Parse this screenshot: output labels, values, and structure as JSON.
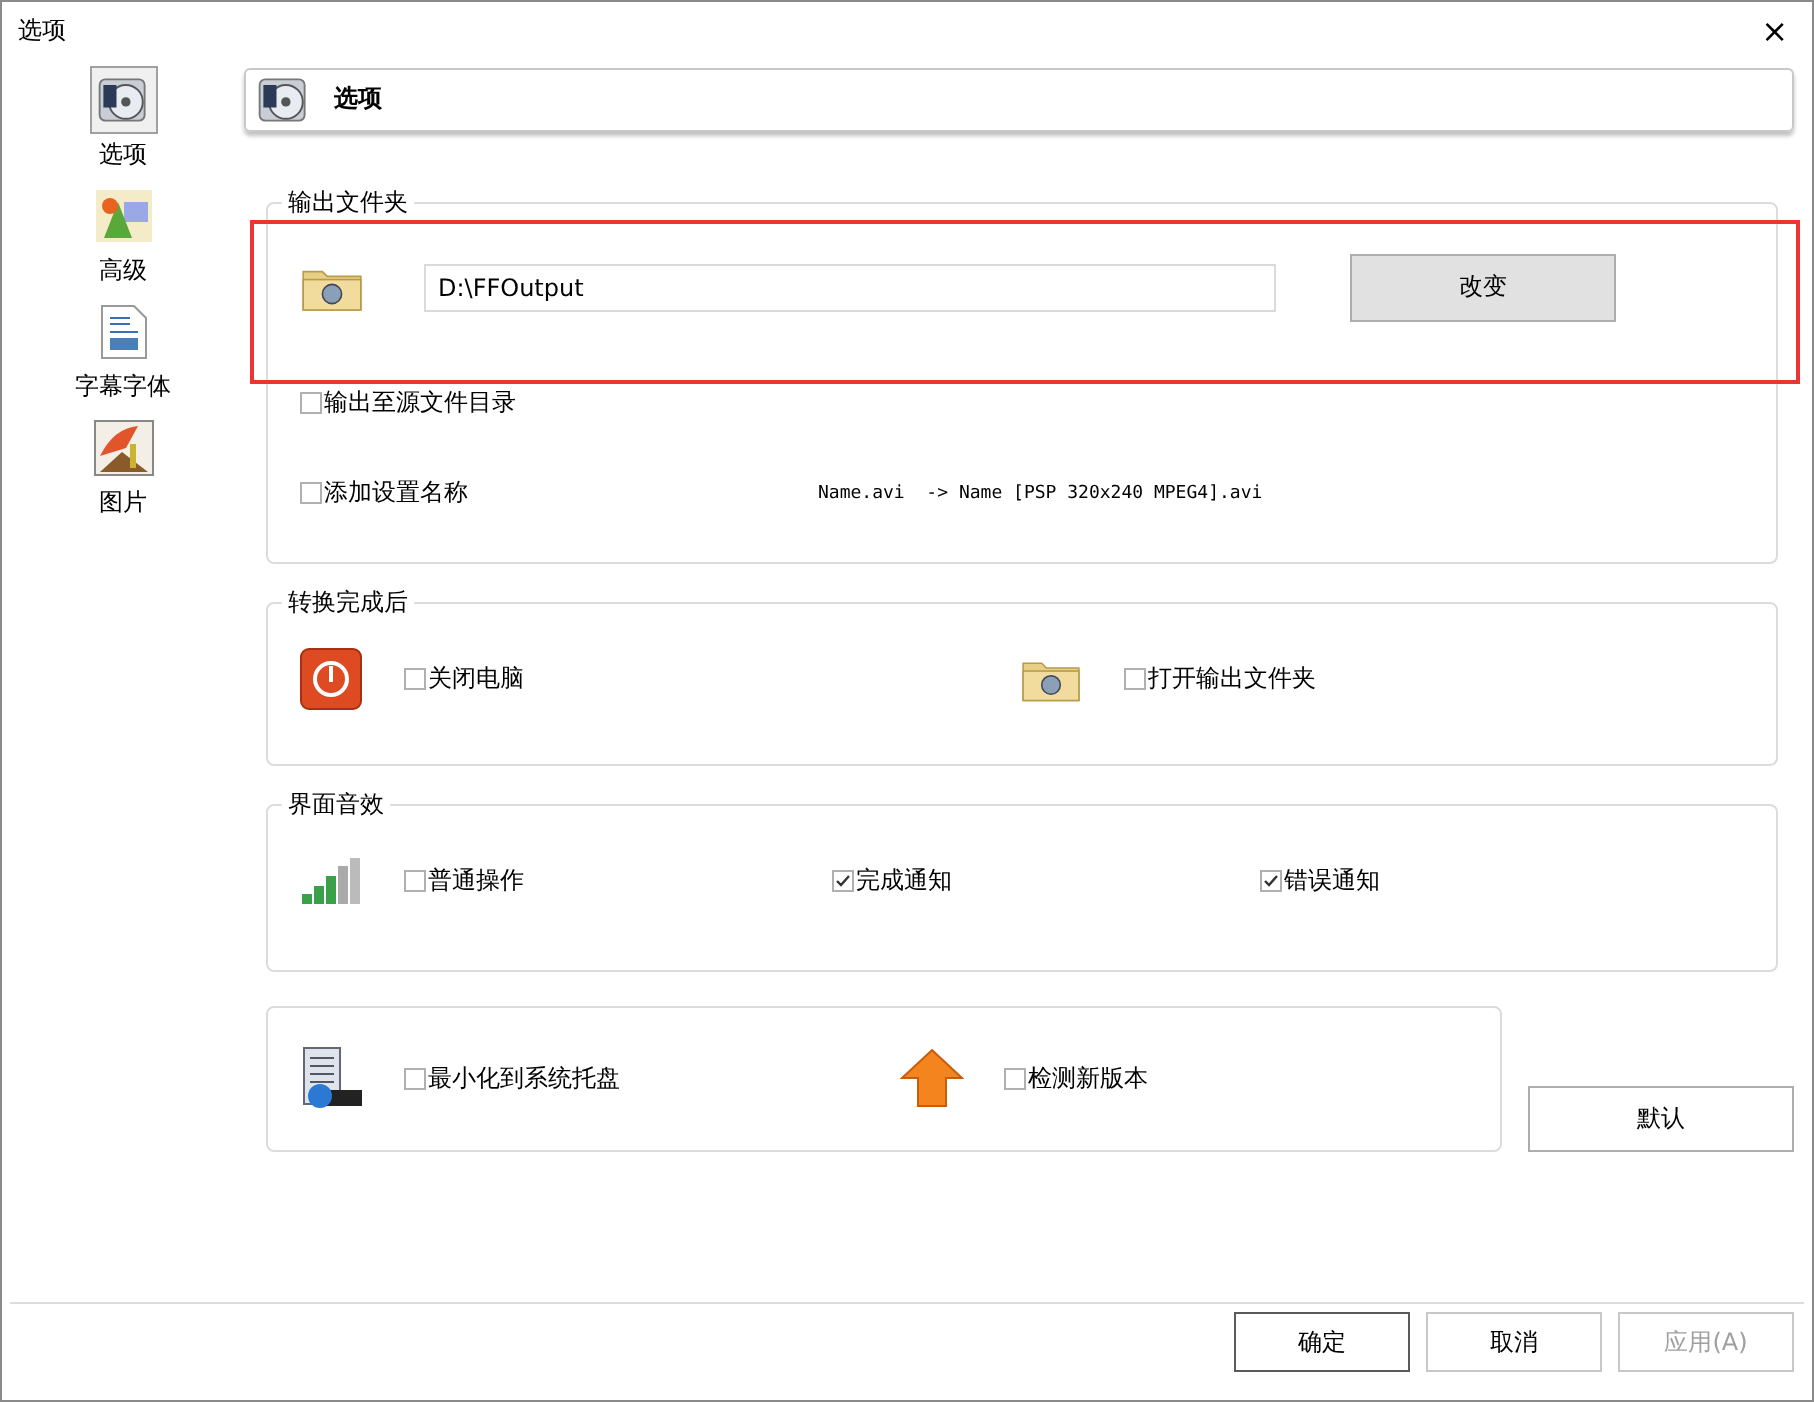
{
  "window": {
    "title": "选项",
    "close": "×"
  },
  "sidebar": {
    "items": [
      {
        "kind": "options",
        "label": "选项",
        "selected": true
      },
      {
        "kind": "advanced",
        "label": "高级",
        "selected": false
      },
      {
        "kind": "subtitle",
        "label": "字幕字体",
        "selected": false
      },
      {
        "kind": "picture",
        "label": "图片",
        "selected": false
      }
    ]
  },
  "header": {
    "title": "选项"
  },
  "output_folder": {
    "title": "输出文件夹",
    "path": "D:\\FFOutput",
    "change_button": "改变",
    "highlighted": true,
    "options": [
      {
        "label": "输出至源文件目录",
        "checked": false
      },
      {
        "label": "添加设置名称",
        "checked": false,
        "example": "Name.avi  -> Name [PSP 320x240 MPEG4].avi"
      }
    ]
  },
  "after_conversion": {
    "title": "转换完成后",
    "options": [
      {
        "kind": "power",
        "label": "关闭电脑",
        "checked": false
      },
      {
        "kind": "folder",
        "label": "打开输出文件夹",
        "checked": false
      }
    ]
  },
  "sounds": {
    "title": "界面音效",
    "options": [
      {
        "label": "普通操作",
        "checked": false
      },
      {
        "label": "完成通知",
        "checked": true
      },
      {
        "label": "错误通知",
        "checked": true
      }
    ]
  },
  "misc": {
    "options": [
      {
        "kind": "tray",
        "label": "最小化到系统托盘",
        "checked": false
      },
      {
        "kind": "update",
        "label": "检测新版本",
        "checked": false
      }
    ]
  },
  "default_button": "默认",
  "buttons": [
    {
      "label": "确定",
      "default": true,
      "disabled": false
    },
    {
      "label": "取消",
      "default": false,
      "disabled": false
    },
    {
      "label": "应用(A)",
      "default": false,
      "disabled": true
    }
  ]
}
